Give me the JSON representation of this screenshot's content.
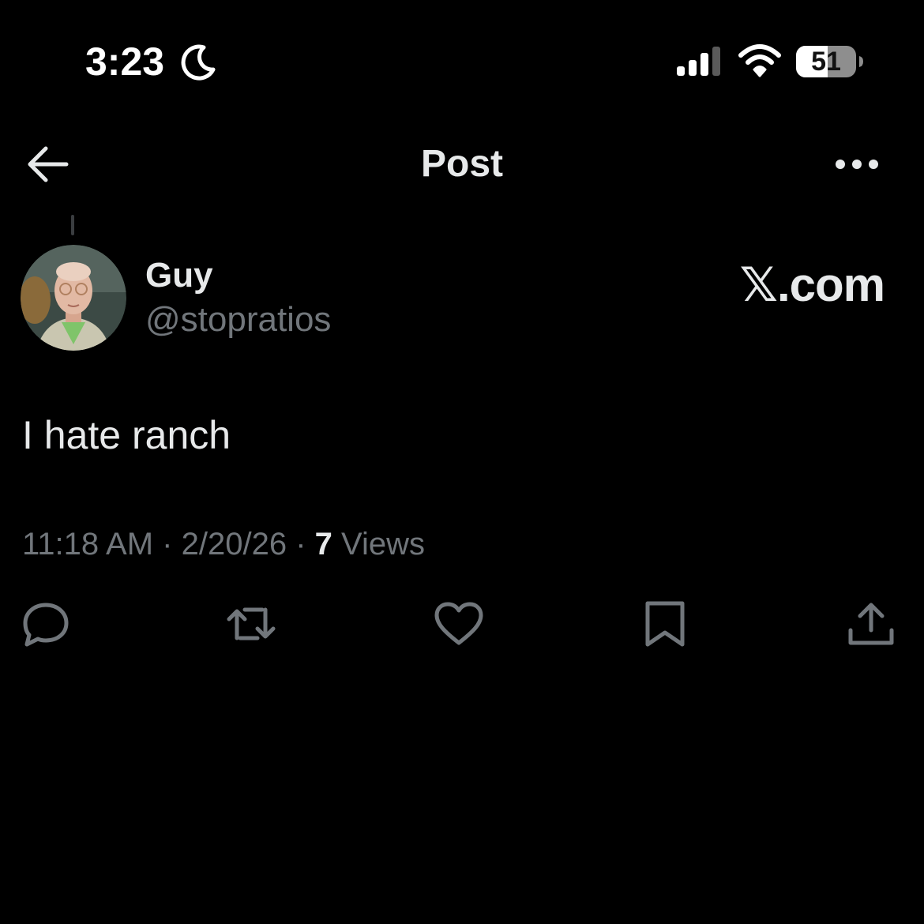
{
  "status_bar": {
    "time": "3:23",
    "battery": "51",
    "icons": [
      "moon-icon",
      "cellular-signal-icon",
      "wifi-icon",
      "battery-icon"
    ]
  },
  "nav": {
    "title": "Post",
    "icons": [
      "back-arrow-icon",
      "more-options-icon"
    ]
  },
  "post": {
    "author_name": "Guy",
    "author_handle": "@stopratios",
    "watermark": "𝕏.com",
    "text": "I hate ranch",
    "time": "11:18 AM",
    "date": "2/20/26",
    "views_count": "7",
    "views_label": "Views",
    "separator": "·"
  },
  "actions": {
    "icons": [
      "reply-icon",
      "repost-icon",
      "like-icon",
      "bookmark-icon",
      "share-icon"
    ]
  },
  "colors": {
    "background": "#000000",
    "primary_text": "#e7e9ea",
    "secondary_text": "#71767b"
  }
}
